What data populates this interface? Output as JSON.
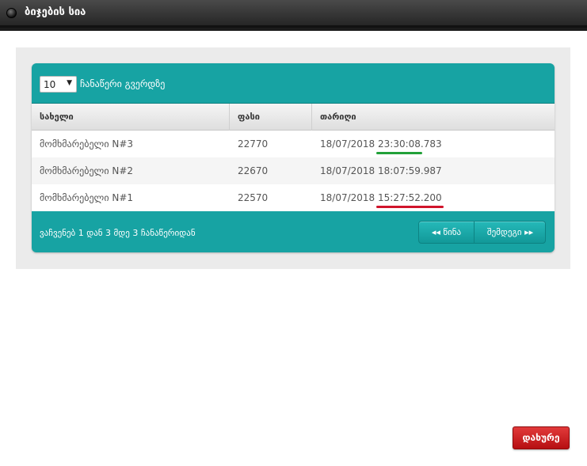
{
  "window": {
    "title": "ბიჯების სია"
  },
  "table": {
    "page_size": "10",
    "page_size_label": "ჩანაწერი გვერდზე",
    "columns": [
      "სახელი",
      "ფასი",
      "თარიღი"
    ],
    "rows": [
      {
        "name": "მომხმარებელი N#3",
        "price": "22770",
        "date": "18/07/2018",
        "time": "23:30:08",
        "ms": ".783",
        "highlight": "green"
      },
      {
        "name": "მომხმარებელი N#2",
        "price": "22670",
        "date": "18/07/2018",
        "time": "18:07:59",
        "ms": ".987",
        "highlight": ""
      },
      {
        "name": "მომხმარებელი N#1",
        "price": "22570",
        "date": "18/07/2018",
        "time": "15:27:52",
        "ms": ".200",
        "highlight": "red"
      }
    ],
    "info": "ვაჩვენებ 1 დან 3 მდე 3 ჩანაწერიდან",
    "prev_label": "◂◂ წინა",
    "next_label": "შემდეგი ▸▸"
  },
  "footer": {
    "close_label": "დახურე"
  },
  "colors": {
    "teal": "#17a3a3",
    "green_mark": "#21a038",
    "red_mark": "#d0142b",
    "close_red": "#c8161a"
  }
}
